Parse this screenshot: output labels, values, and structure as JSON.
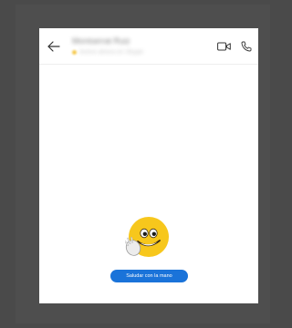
{
  "chat_header": {
    "contact_name": "Montserrat Ruiz",
    "contact_status": "Activo ahora en Skype"
  },
  "icons": {
    "back": "arrow-left-icon",
    "video_call": "video-camera-icon",
    "audio_call": "phone-icon",
    "emoji": "waving-smiley-emoji"
  },
  "empty_state": {
    "wave_button_label": "Saludar con la mano"
  },
  "colors": {
    "accent": "#1a73d9",
    "emoji_yellow": "#f7c71c",
    "background": "#4a4a4a",
    "screen": "#ffffff"
  }
}
